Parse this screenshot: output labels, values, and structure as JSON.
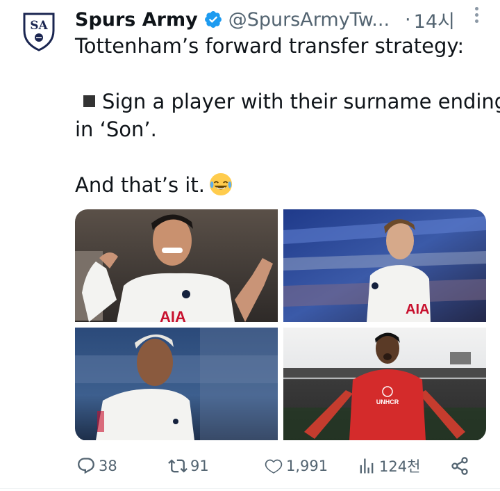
{
  "author": {
    "name": "Spurs Army",
    "handle": "@SpursArmyTw...",
    "separator": "·",
    "time": "14시",
    "avatar_initials": "SA",
    "verified_icon": "verified-badge-icon",
    "verified_color": "#1d9bf0"
  },
  "tweet": {
    "line1": "Tottenham’s forward transfer strategy:",
    "line2": "Sign a player with their surname ending",
    "line3": "in ‘Son’.",
    "line4": "And that’s it.",
    "emoji": "face-with-tears-of-joy"
  },
  "media": {
    "photos": [
      {
        "id": "photo-1",
        "kit_text": "AIA"
      },
      {
        "id": "photo-2",
        "kit_text": "AIA"
      },
      {
        "id": "photo-3",
        "kit_text": ""
      },
      {
        "id": "photo-4",
        "kit_text": "UNHCR"
      }
    ]
  },
  "actions": {
    "replies": "38",
    "retweets": "91",
    "likes": "1,991",
    "views": "124천"
  },
  "colors": {
    "text_primary": "#0f1419",
    "text_secondary": "#536471",
    "accent": "#1d9bf0"
  }
}
